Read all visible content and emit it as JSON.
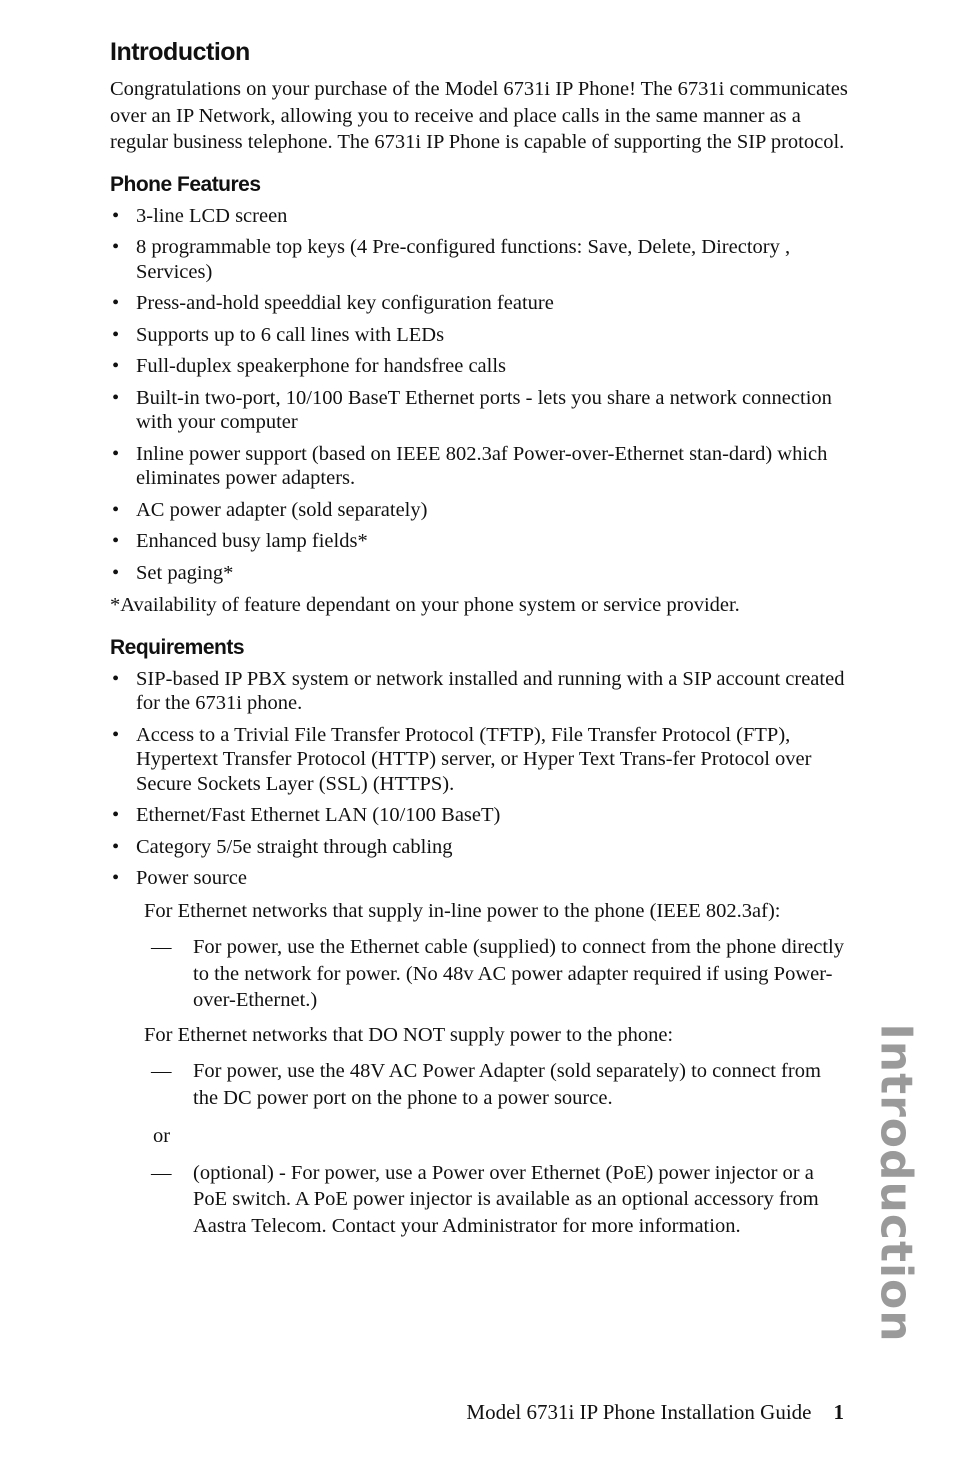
{
  "heading": "Introduction",
  "intro_paragraph": "Congratulations on your purchase of the Model 6731i IP Phone! The 6731i communicates over an IP Network, allowing you to receive and place calls in the same manner as a regular business telephone. The 6731i IP Phone is capable of supporting the SIP protocol.",
  "features": {
    "title": "Phone Features",
    "items": [
      "3-line LCD screen",
      "8 programmable top keys (4 Pre-configured functions: Save, Delete, Directory , Services)",
      "Press-and-hold speeddial key configuration feature",
      "Supports up to 6 call lines with LEDs",
      "Full-duplex speakerphone for handsfree calls",
      "Built-in two-port, 10/100 BaseT Ethernet ports - lets you share a network connection with your computer",
      "Inline power support (based on IEEE 802.3af Power-over-Ethernet stan-dard) which eliminates power adapters.",
      "AC power adapter (sold separately)",
      "Enhanced busy lamp fields*",
      "Set paging*"
    ],
    "footnote": "*Availability of feature dependant on your phone system or service provider."
  },
  "requirements": {
    "title": "Requirements",
    "items": [
      "SIP-based IP PBX system or network installed and running with a SIP account created for the 6731i phone.",
      "Access to a Trivial File Transfer Protocol (TFTP), File Transfer Protocol (FTP), Hypertext Transfer Protocol (HTTP) server, or Hyper Text Trans-fer Protocol over Secure Sockets Layer (SSL) (HTTPS).",
      "Ethernet/Fast Ethernet LAN (10/100 BaseT)",
      "Category 5/5e straight through cabling",
      "Power source"
    ],
    "power": {
      "poe_intro": "For Ethernet networks that supply in-line power to the phone (IEEE 802.3af):",
      "poe_item": "For power, use the Ethernet cable (supplied) to connect from the phone directly to the network for power. (No 48v AC power adapter required if using Power-over-Ethernet.)",
      "non_poe_intro": "For Ethernet networks that DO NOT supply power to the phone:",
      "non_poe_item_1": "For power, use the 48V AC Power Adapter (sold separately) to connect from the DC power port on the phone to a power source.",
      "or_label": "or",
      "non_poe_item_2": "(optional) - For power, use a Power over Ethernet (PoE) power injector or a PoE switch. A PoE power injector is available as an optional accessory from Aastra Telecom. Contact your Administrator for more information.",
      "dash_glyph": "—"
    }
  },
  "bullet_glyph": "•",
  "side_tab_label": "Introduction",
  "footer": {
    "title": "Model 6731i IP Phone Installation Guide",
    "page_number": "1"
  }
}
